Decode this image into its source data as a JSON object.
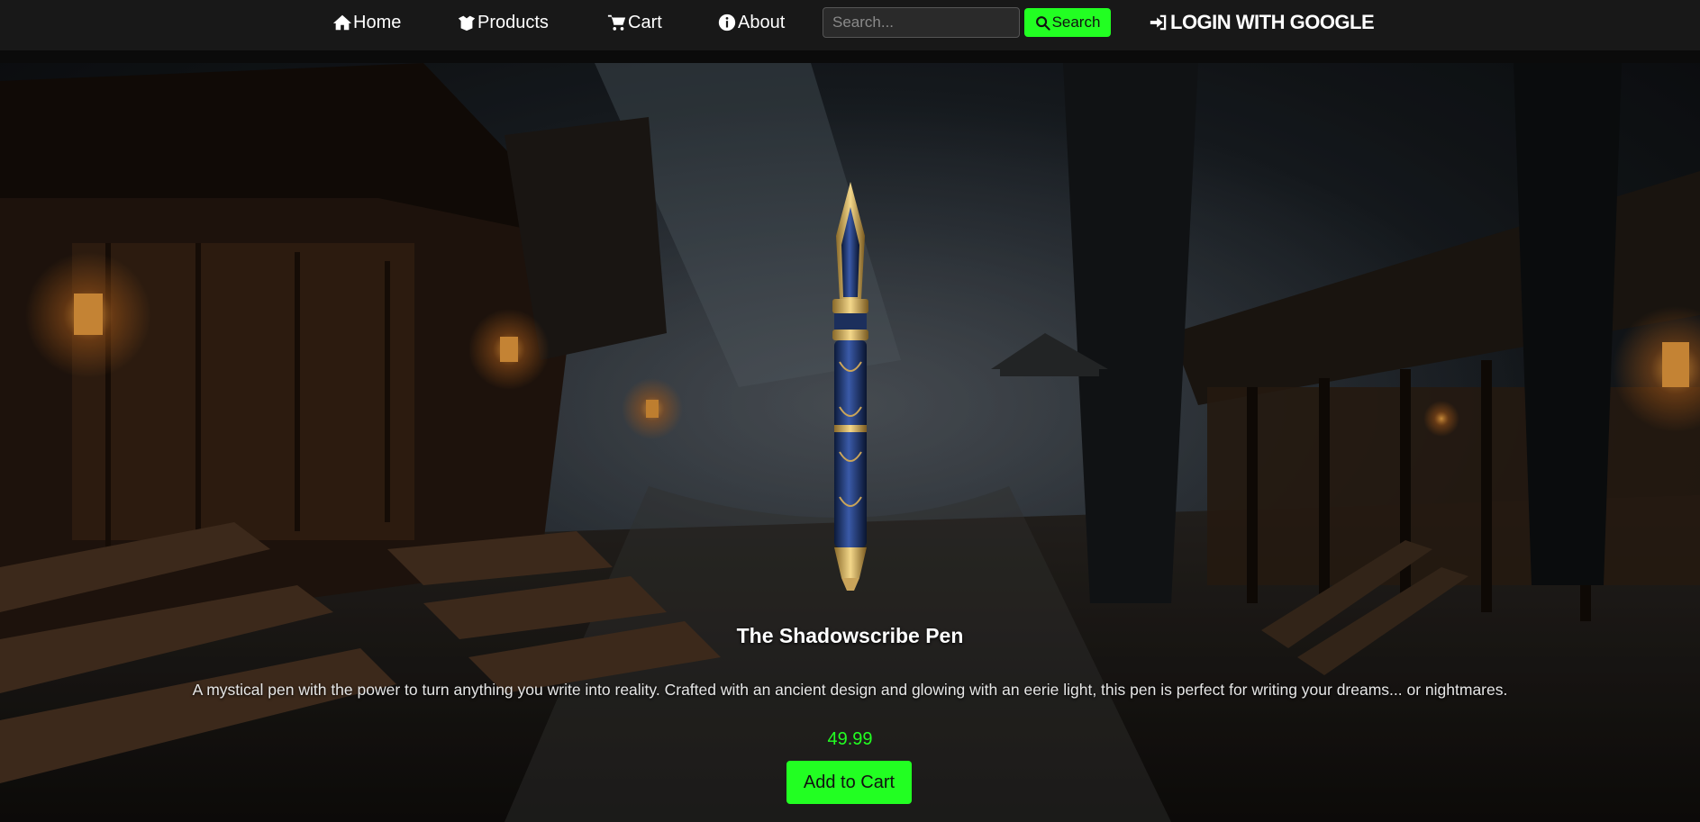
{
  "nav": {
    "home_label": "Home",
    "products_label": "Products",
    "cart_label": "Cart",
    "about_label": "About",
    "login_label": "LOGIN WITH GOOGLE"
  },
  "search": {
    "placeholder": "Search...",
    "button_label": "Search"
  },
  "product": {
    "title": "The Shadowscribe Pen",
    "description": "A mystical pen with the power to turn anything you write into reality. Crafted with an ancient design and glowing with an eerie light, this pen is perfect for writing your dreams... or nightmares.",
    "price": "49.99",
    "add_to_cart_label": "Add to Cart"
  },
  "colors": {
    "accent": "#22ff22",
    "navbar": "#181818"
  }
}
